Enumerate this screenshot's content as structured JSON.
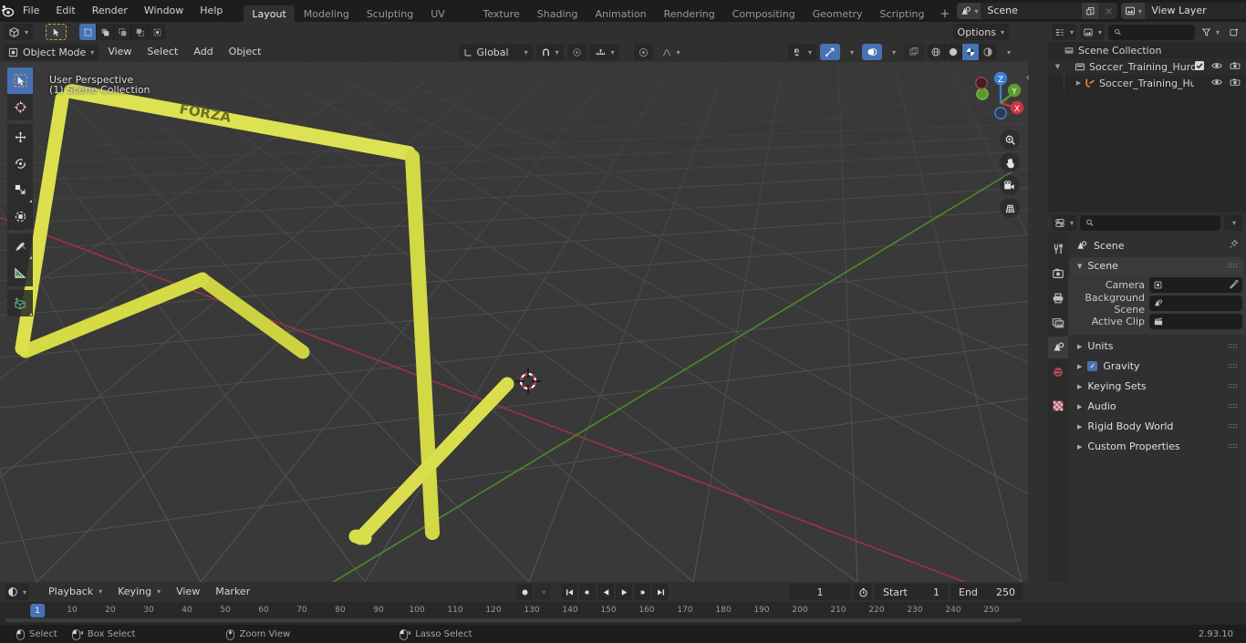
{
  "app": {
    "name": "Blender",
    "version": "2.93.10"
  },
  "topbar": {
    "logo_icon": "blender-logo-icon",
    "menus": [
      "File",
      "Edit",
      "Render",
      "Window",
      "Help"
    ],
    "workspace_tabs": [
      {
        "label": "Layout",
        "active": true
      },
      {
        "label": "Modeling",
        "active": false
      },
      {
        "label": "Sculpting",
        "active": false
      },
      {
        "label": "UV Editing",
        "active": false
      },
      {
        "label": "Texture Paint",
        "active": false
      },
      {
        "label": "Shading",
        "active": false
      },
      {
        "label": "Animation",
        "active": false
      },
      {
        "label": "Rendering",
        "active": false
      },
      {
        "label": "Compositing",
        "active": false
      },
      {
        "label": "Geometry Nodes",
        "active": false
      },
      {
        "label": "Scripting",
        "active": false
      }
    ],
    "add_workspace_label": "+",
    "scene_selector": {
      "icon": "scene-icon",
      "value": "Scene",
      "new_label": "copy-icon",
      "unlink_label": "x-icon"
    },
    "viewlayer_selector": {
      "icon": "view-layer-icon",
      "value": "View Layer",
      "new_label": "copy-icon",
      "unlink_label": "x-icon"
    }
  },
  "viewport_header": {
    "editor_type_icon": "editor-type-3dview-icon",
    "cursor_tool_icon": "cursor-select-icon",
    "select_modes": [
      "select-new-icon",
      "select-extend-icon",
      "select-subtract-icon",
      "select-invert-icon",
      "select-intersect-icon"
    ],
    "mode": "Object Mode",
    "mode_icon": "object-mode-icon",
    "menus": [
      "View",
      "Select",
      "Add",
      "Object"
    ],
    "transform_orientation": "Global",
    "orientation_icon": "orientation-global-icon",
    "snap_icon": "magnet-icon",
    "proportional_icon": "proportional-edit-icon",
    "proportional_falloff_icon": "falloff-smooth-icon",
    "options_label": "Options",
    "visibility_icon": "object-visibility-icon",
    "gizmo_icon": "gizmo-icon",
    "overlays_icon": "overlays-icon",
    "xray_icon": "xray-icon",
    "shading_modes": [
      "wireframe-icon",
      "solid-icon",
      "material-preview-icon",
      "rendered-icon"
    ],
    "shading_active_index": 2
  },
  "viewport": {
    "overlay_line1": "User Perspective",
    "overlay_line2": "(1) Scene Collection",
    "object_text": "FORZA",
    "object_color": "#dbe14b",
    "background_color": "#393939",
    "grid_color": "#4b4b4b",
    "x_axis_color": "#b8384a",
    "y_axis_color": "#5a9b2f",
    "z_axis_color": "#3b7fd4",
    "cursor_name": "3d-cursor",
    "toolbar_tools": [
      {
        "name": "tweak-tool",
        "icon": "cursor-arrow-icon",
        "selected": true
      },
      {
        "name": "cursor-tool",
        "icon": "3d-cursor-icon",
        "selected": false
      },
      {
        "name": "move-tool",
        "icon": "move-arrows-icon",
        "selected": false
      },
      {
        "name": "rotate-tool",
        "icon": "rotate-icon",
        "selected": false
      },
      {
        "name": "scale-tool",
        "icon": "scale-icon",
        "selected": false
      },
      {
        "name": "transform-tool",
        "icon": "transform-icon",
        "selected": false
      },
      {
        "name": "annotate-tool",
        "icon": "annotate-pencil-icon",
        "selected": false
      },
      {
        "name": "measure-tool",
        "icon": "measure-ruler-icon",
        "selected": false
      },
      {
        "name": "add-cube-tool",
        "icon": "add-cube-icon",
        "selected": false
      }
    ],
    "gizmo": {
      "axes": [
        {
          "label": "Z",
          "color": "#3b7fd4"
        },
        {
          "label": "Y",
          "color": "#5a9b2f"
        },
        {
          "label": "X",
          "color": "#cc3344"
        }
      ]
    },
    "nav_buttons": [
      {
        "name": "zoom-view-button",
        "icon": "magnifier-plus-icon"
      },
      {
        "name": "pan-view-button",
        "icon": "hand-icon"
      },
      {
        "name": "camera-view-button",
        "icon": "camera-icon"
      },
      {
        "name": "toggle-perspective-button",
        "icon": "perspective-grid-icon"
      }
    ]
  },
  "outliner": {
    "editor_type_icon": "editor-type-outliner-icon",
    "display_mode_icon": "display-mode-viewlayer-icon",
    "search_placeholder": "",
    "filter_icon": "filter-funnel-icon",
    "new_collection_icon": "new-collection-icon",
    "rows": [
      {
        "indent": 0,
        "tri": "",
        "icon": "scene-collection-icon",
        "label": "Scene Collection",
        "checkbox": false,
        "eye": false,
        "camera": false
      },
      {
        "indent": 1,
        "tri": "▼",
        "icon": "collection-icon",
        "label": "Soccer_Training_Hurdle_Forza",
        "checkbox": true,
        "eye": true,
        "camera": true
      },
      {
        "indent": 2,
        "tri": "▶",
        "icon": "mesh-data-icon",
        "label": "Soccer_Training_Hurdle_F",
        "checkbox": false,
        "eye": true,
        "camera": true
      }
    ]
  },
  "properties": {
    "editor_type_icon": "editor-type-properties-icon",
    "search_placeholder": "",
    "options_chevron": "chevron-down-icon",
    "tabs": [
      {
        "name": "tool-tab",
        "icon": "tool-wrench-icon",
        "selected": false
      },
      {
        "name": "render-tab",
        "icon": "render-camera-back-icon",
        "selected": false
      },
      {
        "name": "output-tab",
        "icon": "output-printer-icon",
        "selected": false
      },
      {
        "name": "viewlayer-tab",
        "icon": "view-layer-images-icon",
        "selected": false
      },
      {
        "name": "scene-tab",
        "icon": "scene-cone-icon",
        "selected": true
      },
      {
        "name": "world-tab",
        "icon": "world-globe-icon",
        "selected": false
      },
      {
        "name": "texture-tab",
        "icon": "texture-checker-icon",
        "selected": false
      }
    ],
    "breadcrumb": {
      "icon": "scene-cone-icon",
      "label": "Scene",
      "pin_icon": "pin-icon"
    },
    "panels": [
      {
        "label": "Scene",
        "open": true,
        "has_checkbox": false
      },
      {
        "label": "Units",
        "open": false,
        "has_checkbox": false
      },
      {
        "label": "Gravity",
        "open": false,
        "has_checkbox": true,
        "checked": true
      },
      {
        "label": "Keying Sets",
        "open": false,
        "has_checkbox": false
      },
      {
        "label": "Audio",
        "open": false,
        "has_checkbox": false
      },
      {
        "label": "Rigid Body World",
        "open": false,
        "has_checkbox": false
      },
      {
        "label": "Custom Properties",
        "open": false,
        "has_checkbox": false
      }
    ],
    "scene_fields": [
      {
        "label": "Camera",
        "value": "",
        "icon": "camera-object-icon",
        "extra_icon": "eyedropper-icon"
      },
      {
        "label": "Background Scene",
        "value": "",
        "icon": "scene-cone-icon",
        "extra_icon": ""
      },
      {
        "label": "Active Clip",
        "value": "",
        "icon": "movie-clip-icon",
        "extra_icon": ""
      }
    ]
  },
  "timeline": {
    "editor_type_icon": "editor-type-timeline-icon",
    "menus": [
      {
        "label": "Playback",
        "has_chevron": true
      },
      {
        "label": "Keying",
        "has_chevron": true
      },
      {
        "label": "View",
        "has_chevron": false
      },
      {
        "label": "Marker",
        "has_chevron": false
      }
    ],
    "record_icon": "record-dot-icon",
    "record_chevron": "chevron-down-icon",
    "transport": [
      {
        "name": "jump-to-start-button",
        "icon": "jump-start-icon"
      },
      {
        "name": "prev-keyframe-button",
        "icon": "prev-keyframe-icon"
      },
      {
        "name": "play-reverse-button",
        "icon": "play-reverse-icon"
      },
      {
        "name": "play-button",
        "icon": "play-icon"
      },
      {
        "name": "next-keyframe-button",
        "icon": "next-keyframe-icon"
      },
      {
        "name": "jump-to-end-button",
        "icon": "jump-end-icon"
      }
    ],
    "current_frame": "1",
    "use_preview_range_icon": "stopwatch-icon",
    "start_label": "Start",
    "start_value": "1",
    "end_label": "End",
    "end_value": "250",
    "playhead_frame": "1",
    "ticks": [
      "10",
      "20",
      "30",
      "40",
      "50",
      "60",
      "70",
      "80",
      "90",
      "100",
      "110",
      "120",
      "130",
      "140",
      "150",
      "160",
      "170",
      "180",
      "190",
      "200",
      "210",
      "220",
      "230",
      "240",
      "250"
    ]
  },
  "statusbar": {
    "items": [
      {
        "icon": "mouse-left-icon",
        "label": "Select"
      },
      {
        "icon": "mouse-left-drag-icon",
        "label": "Box Select"
      },
      {
        "icon": "mouse-middle-icon",
        "label": "Zoom View"
      },
      {
        "icon": "mouse-left-drag-icon",
        "label": "Lasso Select"
      }
    ],
    "version": "2.93.10"
  }
}
